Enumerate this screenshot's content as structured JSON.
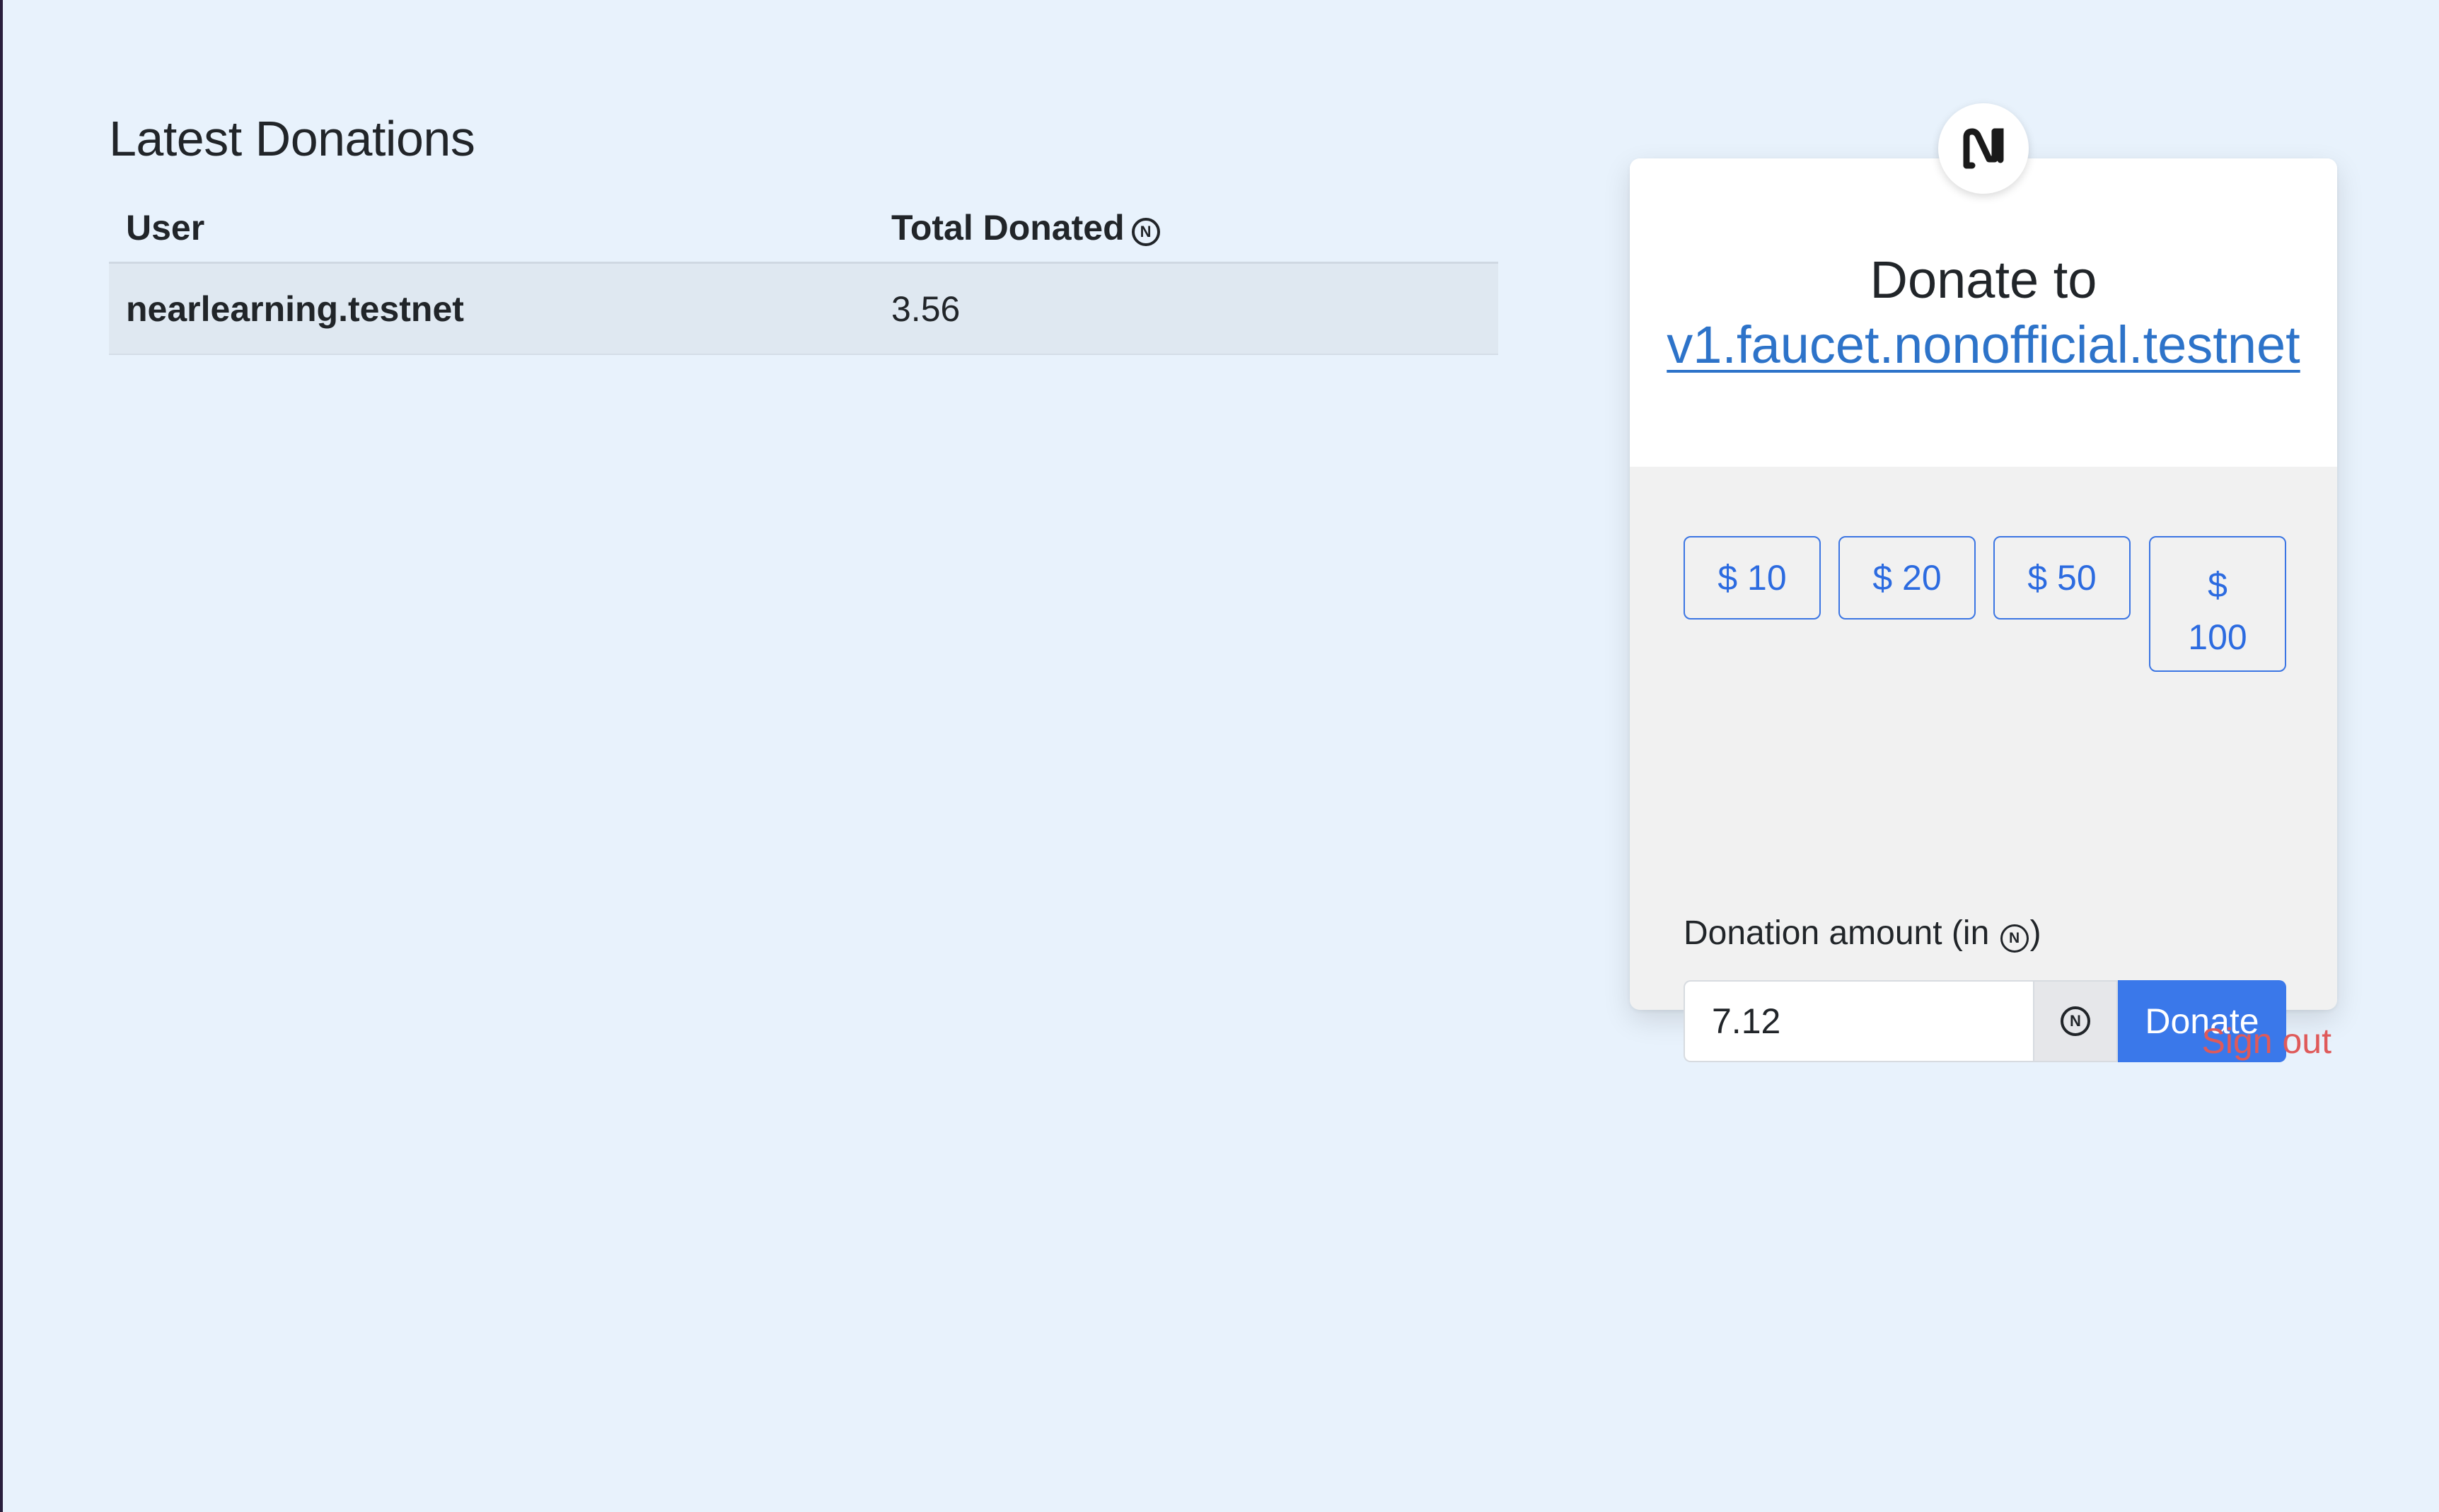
{
  "donations": {
    "title": "Latest Donations",
    "columns": {
      "user": "User",
      "total": "Total Donated"
    },
    "currency_symbol": "Ⓝ",
    "rows": [
      {
        "user": "nearlearning.testnet",
        "total": "3.56"
      }
    ]
  },
  "donate_card": {
    "logo_icon": "near-logo-icon",
    "title": "Donate to",
    "beneficiary": "v1.faucet.nonofficial.testnet",
    "preset_buttons": [
      {
        "currency": "$",
        "amount": "10"
      },
      {
        "currency": "$",
        "amount": "20"
      },
      {
        "currency": "$",
        "amount": "50"
      },
      {
        "currency": "$",
        "amount": "100"
      }
    ],
    "amount_label_prefix": "Donation amount (in ",
    "amount_label_suffix": ")",
    "amount_value": "7.12",
    "currency_addon": "Ⓝ",
    "donate_label": "Donate"
  },
  "sign_out_label": "Sign out",
  "colors": {
    "background": "#e8f2fc",
    "accent": "#3a78ea",
    "link": "#2d73c9",
    "danger": "#df5a5a"
  }
}
